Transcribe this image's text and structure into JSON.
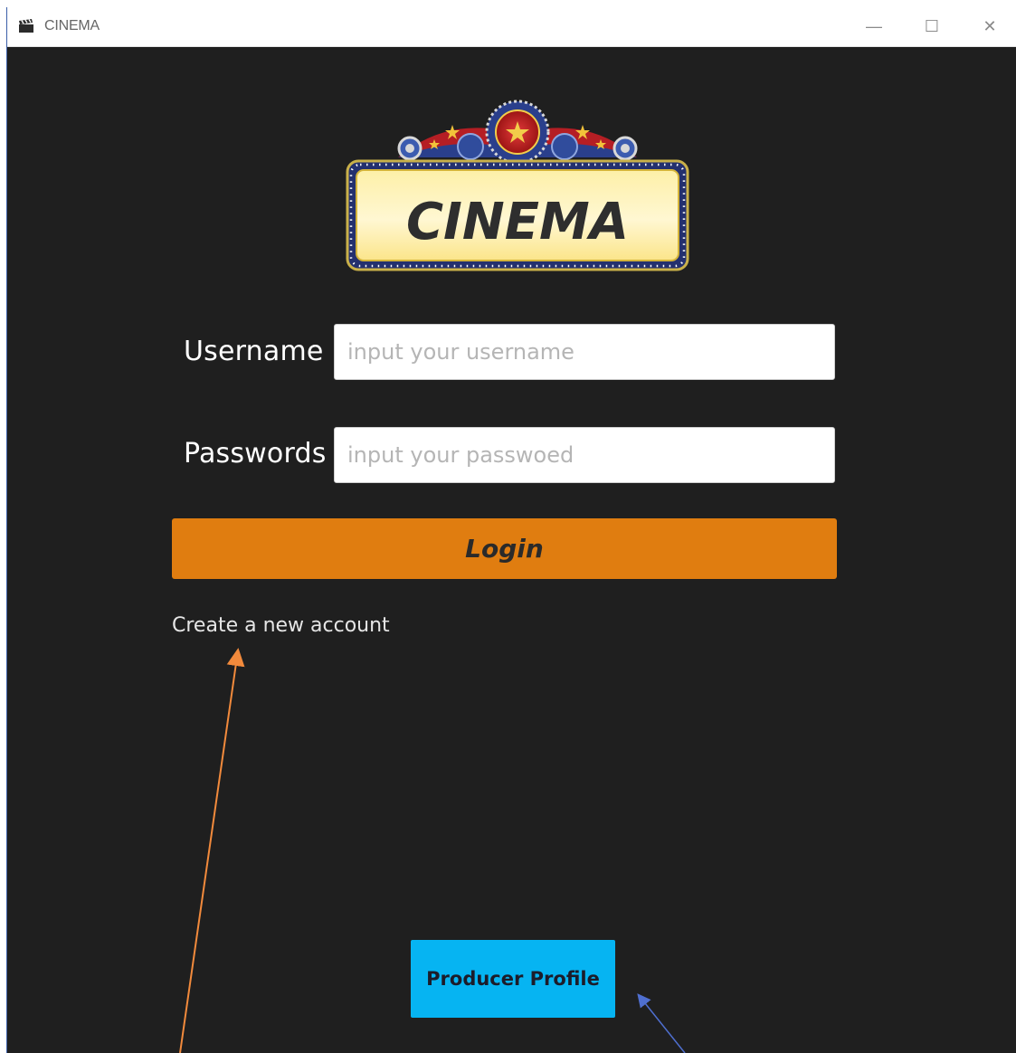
{
  "window": {
    "title": "CINEMA",
    "icon": "clapperboard-icon"
  },
  "window_controls": {
    "minimize": "—",
    "maximize": "☐",
    "close": "✕"
  },
  "logo": {
    "text": "CINEMA"
  },
  "form": {
    "username_label": "Username :",
    "username_placeholder": "input your username",
    "password_label": "Passwords :",
    "password_placeholder": "input your passwoed",
    "login_label": "Login",
    "create_account_label": "Create a new account"
  },
  "footer": {
    "producer_label": "Producer Profile"
  },
  "colors": {
    "window_background": "#1f1f1f",
    "login_button": "#e07d10",
    "producer_button": "#06b4f2",
    "annotation_arrow_orange": "#f28a3c",
    "annotation_arrow_blue": "#4f6fd0"
  }
}
